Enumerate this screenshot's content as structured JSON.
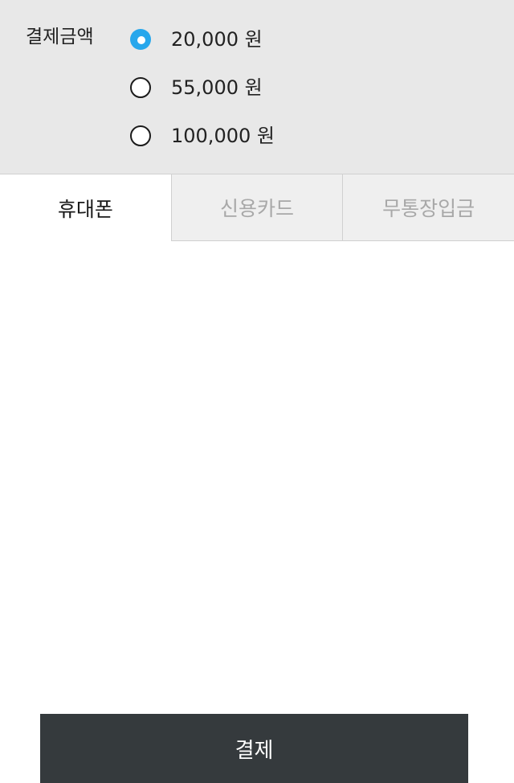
{
  "amount": {
    "label": "결제금액",
    "options": [
      {
        "label": "20,000 원",
        "selected": true
      },
      {
        "label": "55,000 원",
        "selected": false
      },
      {
        "label": "100,000 원",
        "selected": false
      }
    ]
  },
  "tabs": [
    {
      "label": "휴대폰",
      "active": true
    },
    {
      "label": "신용카드",
      "active": false
    },
    {
      "label": "무통장입금",
      "active": false
    }
  ],
  "pay_button": {
    "label": "결제"
  },
  "colors": {
    "accent": "#27a7ec",
    "panel_background": "#e8e8e8",
    "button_background": "#353a3d"
  }
}
